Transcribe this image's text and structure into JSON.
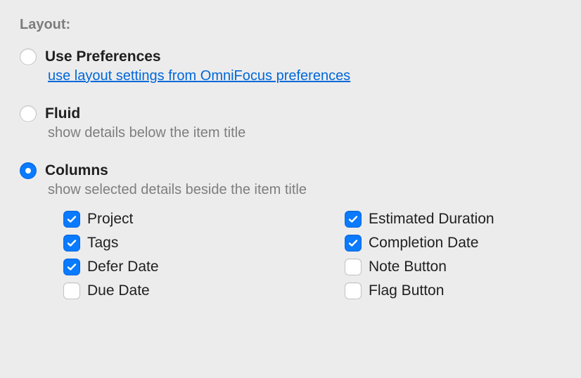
{
  "section": {
    "title": "Layout:"
  },
  "options": {
    "usePreferences": {
      "label": "Use Preferences",
      "link": "use layout settings from OmniFocus preferences",
      "selected": false
    },
    "fluid": {
      "label": "Fluid",
      "description": "show details below the item title",
      "selected": false
    },
    "columns": {
      "label": "Columns",
      "description": "show selected details beside the item title",
      "selected": true,
      "items": [
        {
          "label": "Project",
          "checked": true
        },
        {
          "label": "Tags",
          "checked": true
        },
        {
          "label": "Defer Date",
          "checked": true
        },
        {
          "label": "Due Date",
          "checked": false
        },
        {
          "label": "Estimated Duration",
          "checked": true
        },
        {
          "label": "Completion Date",
          "checked": true
        },
        {
          "label": "Note Button",
          "checked": false
        },
        {
          "label": "Flag Button",
          "checked": false
        }
      ]
    }
  }
}
